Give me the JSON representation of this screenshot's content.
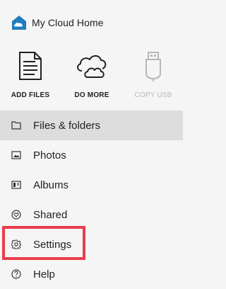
{
  "header": {
    "brand": "My Cloud Home",
    "logo": "house-cloud-logo",
    "accent": "#1f7cbe"
  },
  "actions": [
    {
      "label": "ADD FILES",
      "icon": "document-icon",
      "enabled": true
    },
    {
      "label": "DO MORE",
      "icon": "cloud-icon",
      "enabled": true
    },
    {
      "label": "COPY USB",
      "icon": "usb-icon",
      "enabled": false
    }
  ],
  "nav": {
    "items": [
      {
        "label": "Files & folders",
        "icon": "folder-icon",
        "active": true
      },
      {
        "label": "Photos",
        "icon": "image-icon",
        "active": false
      },
      {
        "label": "Albums",
        "icon": "album-icon",
        "active": false
      },
      {
        "label": "Shared",
        "icon": "heart-icon",
        "active": false
      },
      {
        "label": "Settings",
        "icon": "gear-icon",
        "active": false
      },
      {
        "label": "Help",
        "icon": "help-icon",
        "active": false
      }
    ]
  },
  "colors": {
    "sidebar_bg": "#f5f5f5",
    "active_bg": "#dddddd",
    "highlight_border": "#ea3d4b",
    "disabled_text": "#b8b8b8"
  }
}
